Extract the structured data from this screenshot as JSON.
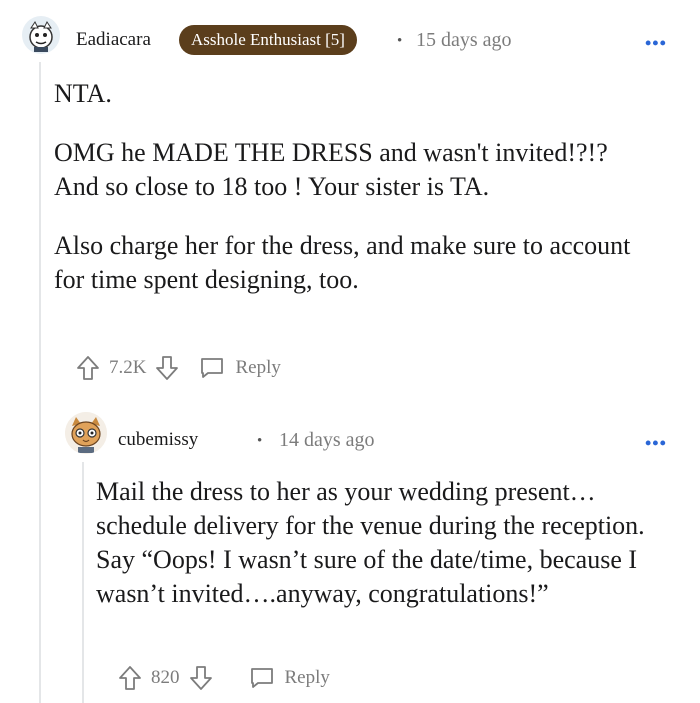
{
  "comment": {
    "username": "Eadiacara",
    "flair": "Asshole Enthusiast [5]",
    "separator": "•",
    "time": "15 days ago",
    "more": "•••",
    "paragraphs": [
      "NTA.",
      "OMG he MADE THE DRESS and wasn't invited!?!? And so close to 18 too ! Your sister is TA.",
      "Also charge her for the dress, and make sure to account for time spent designing, too."
    ],
    "votes": "7.2K",
    "reply_label": "Reply",
    "icons": [
      "upvote-icon",
      "downvote-icon",
      "comment-icon",
      "more-icon"
    ]
  },
  "reply_comment": {
    "username": "cubemissy",
    "separator": "•",
    "time": "14 days ago",
    "more": "•••",
    "paragraphs": [
      "Mail the dress to her as your wedding present…schedule delivery for the venue during the reception. Say “Oops! I wasn’t sure of the date/time, because I wasn’t invited….anyway, congratulations!”"
    ],
    "votes": "820",
    "reply_label": "Reply"
  },
  "colors": {
    "flair_bg": "#5b3e1c",
    "more_icon": "#2a66d6",
    "meta_text": "#7c7c7c",
    "thread_line": "#e4e6e8"
  }
}
